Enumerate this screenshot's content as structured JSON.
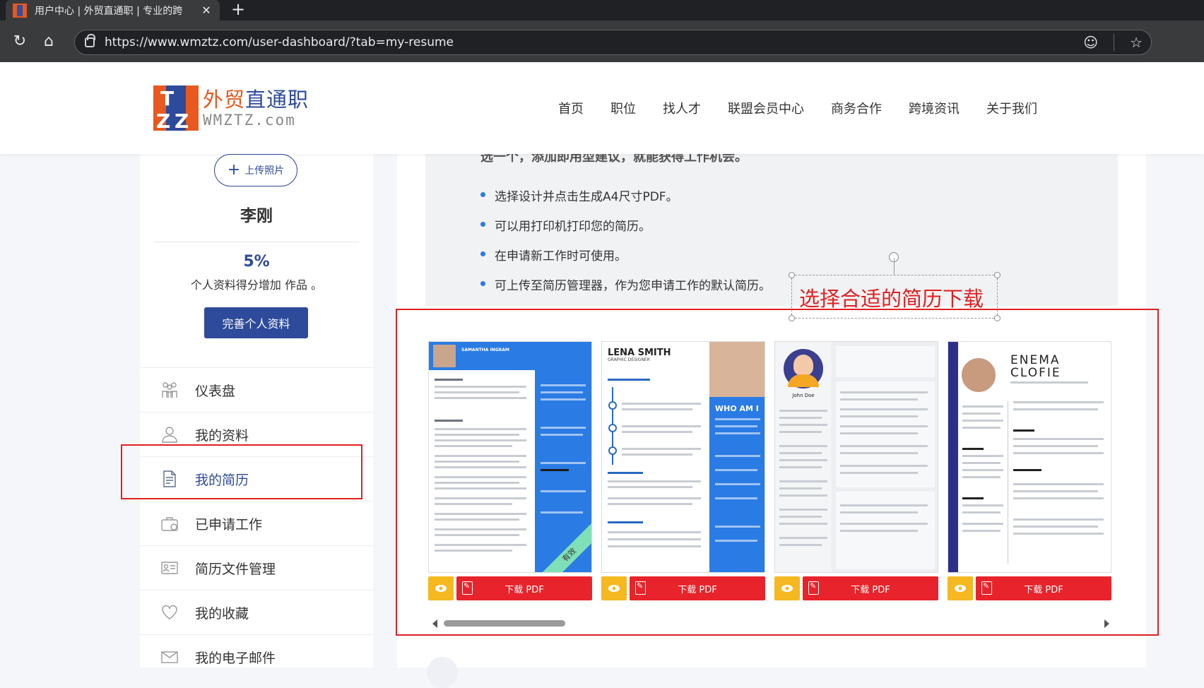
{
  "browser": {
    "tab_title": "用户中心 | 外贸直通职 | 专业的跨",
    "url": "https://www.wmztz.com/user-dashboard/?tab=my-resume"
  },
  "header": {
    "logo_cn_a": "外贸",
    "logo_cn_b": "直通职",
    "logo_en": "WMZTZ.com",
    "nav": [
      "首页",
      "职位",
      "找人才",
      "联盟会员中心",
      "商务合作",
      "跨境资讯",
      "关于我们"
    ]
  },
  "sidebar": {
    "upload_label": "上传照片",
    "user_name": "李刚",
    "profile_percent": "5%",
    "profile_desc": "个人资料得分增加 作品 。",
    "complete_label": "完善个人资料",
    "menu": [
      {
        "label": "仪表盘",
        "icon": "dashboard-icon"
      },
      {
        "label": "我的资料",
        "icon": "user-icon"
      },
      {
        "label": "我的简历",
        "icon": "resume-icon"
      },
      {
        "label": "已申请工作",
        "icon": "briefcase-icon"
      },
      {
        "label": "简历文件管理",
        "icon": "id-card-icon"
      },
      {
        "label": "我的收藏",
        "icon": "heart-icon"
      },
      {
        "label": "我的电子邮件",
        "icon": "mail-icon"
      }
    ]
  },
  "main": {
    "cut_text": "选一个，添加即用型建议，就能获得工作机会。",
    "bullets": [
      "选择设计并点击生成A4尺寸PDF。",
      "可以用打印机打印您的简历。",
      "在申请新工作时可使用。",
      "可上传至简历管理器，作为您申请工作的默认简历。"
    ],
    "annotation": "选择合适的简历下载",
    "templates": [
      {
        "name": "SAMANTHA INGRAM",
        "badge": "有效",
        "download_label": "下载 PDF"
      },
      {
        "name": "LENA SMITH",
        "subtitle": "GRAPHIC DESIGNER",
        "side_title": "WHO AM I",
        "download_label": "下载 PDF"
      },
      {
        "name": "John Doe",
        "download_label": "下载 PDF"
      },
      {
        "name_line1": "ENEMA",
        "name_line2": "CLOFIE",
        "download_label": "下载 PDF"
      }
    ]
  },
  "colors": {
    "brand_blue": "#2e4a9a",
    "brand_orange": "#e8581f",
    "annotation_red": "#e02020",
    "download_red": "#e8232b",
    "view_yellow": "#f5b820"
  }
}
